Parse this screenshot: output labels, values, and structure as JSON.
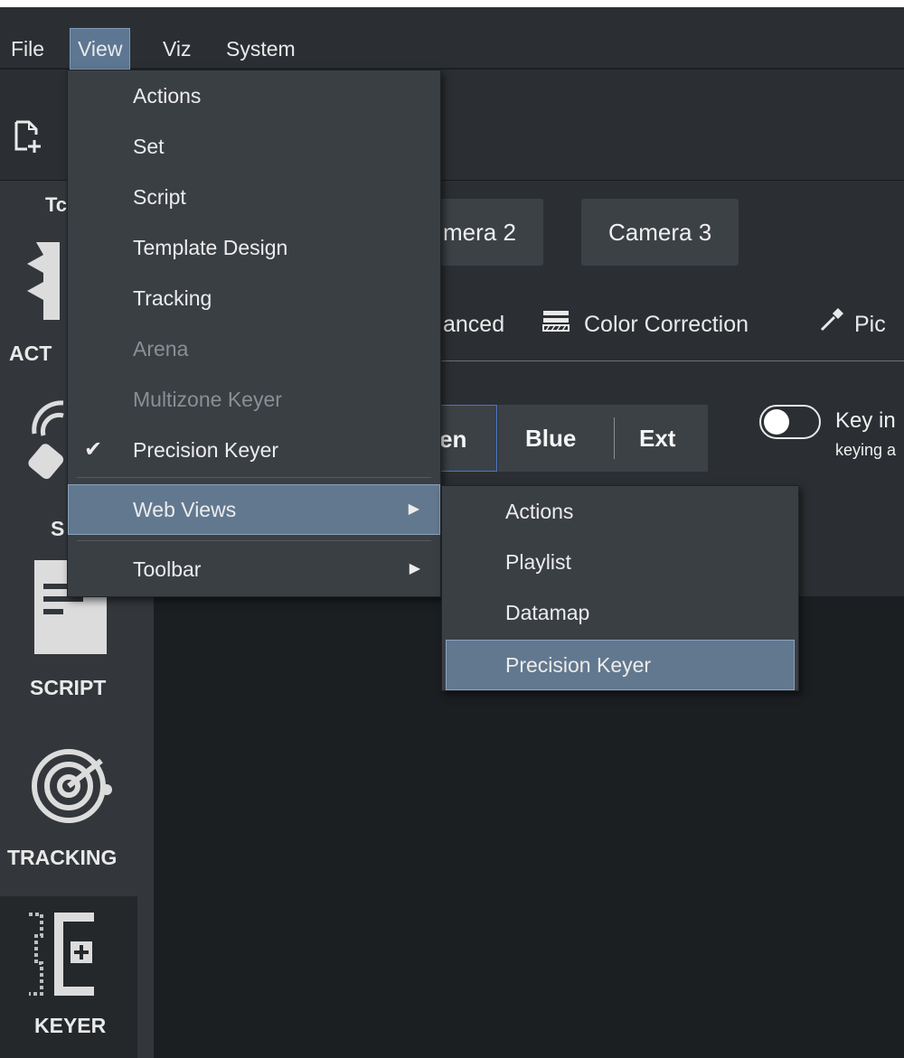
{
  "menubar": {
    "items": [
      {
        "label": "File"
      },
      {
        "label": "View"
      },
      {
        "label": "Viz"
      },
      {
        "label": "System"
      }
    ]
  },
  "toolbar": {
    "new_icon": "new-file-icon"
  },
  "cameras": {
    "camera2": "mera 2",
    "camera3": "Camera 3"
  },
  "subnav": {
    "advanced": "anced",
    "color_correction": "Color Correction",
    "pick": "Pic"
  },
  "keyer": {
    "segments": [
      "en",
      "Blue",
      "Ext"
    ],
    "key_label": "Key in",
    "keying_label": "keying a"
  },
  "sidebar": {
    "header_partial": "Tc",
    "items": [
      {
        "label": "ACT",
        "icon": "actions-icon"
      },
      {
        "label": "S",
        "icon": "set-icon"
      },
      {
        "label": "SCRIPT",
        "icon": "script-icon"
      },
      {
        "label": "TRACKING",
        "icon": "tracking-icon"
      },
      {
        "label": "KEYER",
        "icon": "keyer-icon"
      }
    ]
  },
  "view_menu": {
    "items": [
      {
        "label": "Actions"
      },
      {
        "label": "Set"
      },
      {
        "label": "Script"
      },
      {
        "label": "Template Design"
      },
      {
        "label": "Tracking"
      },
      {
        "label": "Arena"
      },
      {
        "label": "Multizone Keyer"
      },
      {
        "label": "Precision Keyer"
      },
      {
        "label": "Web Views"
      },
      {
        "label": "Toolbar"
      }
    ],
    "check_glyph": "✔",
    "arrow_glyph": "▶"
  },
  "web_views_menu": {
    "items": [
      {
        "label": "Actions"
      },
      {
        "label": "Playlist"
      },
      {
        "label": "Datamap"
      },
      {
        "label": "Precision Keyer"
      }
    ]
  },
  "colors": {
    "highlight": "#62788f",
    "menu_bg": "#3a3f44",
    "panel_bg": "#2b2f33",
    "sidebar_bg": "#33373b"
  }
}
